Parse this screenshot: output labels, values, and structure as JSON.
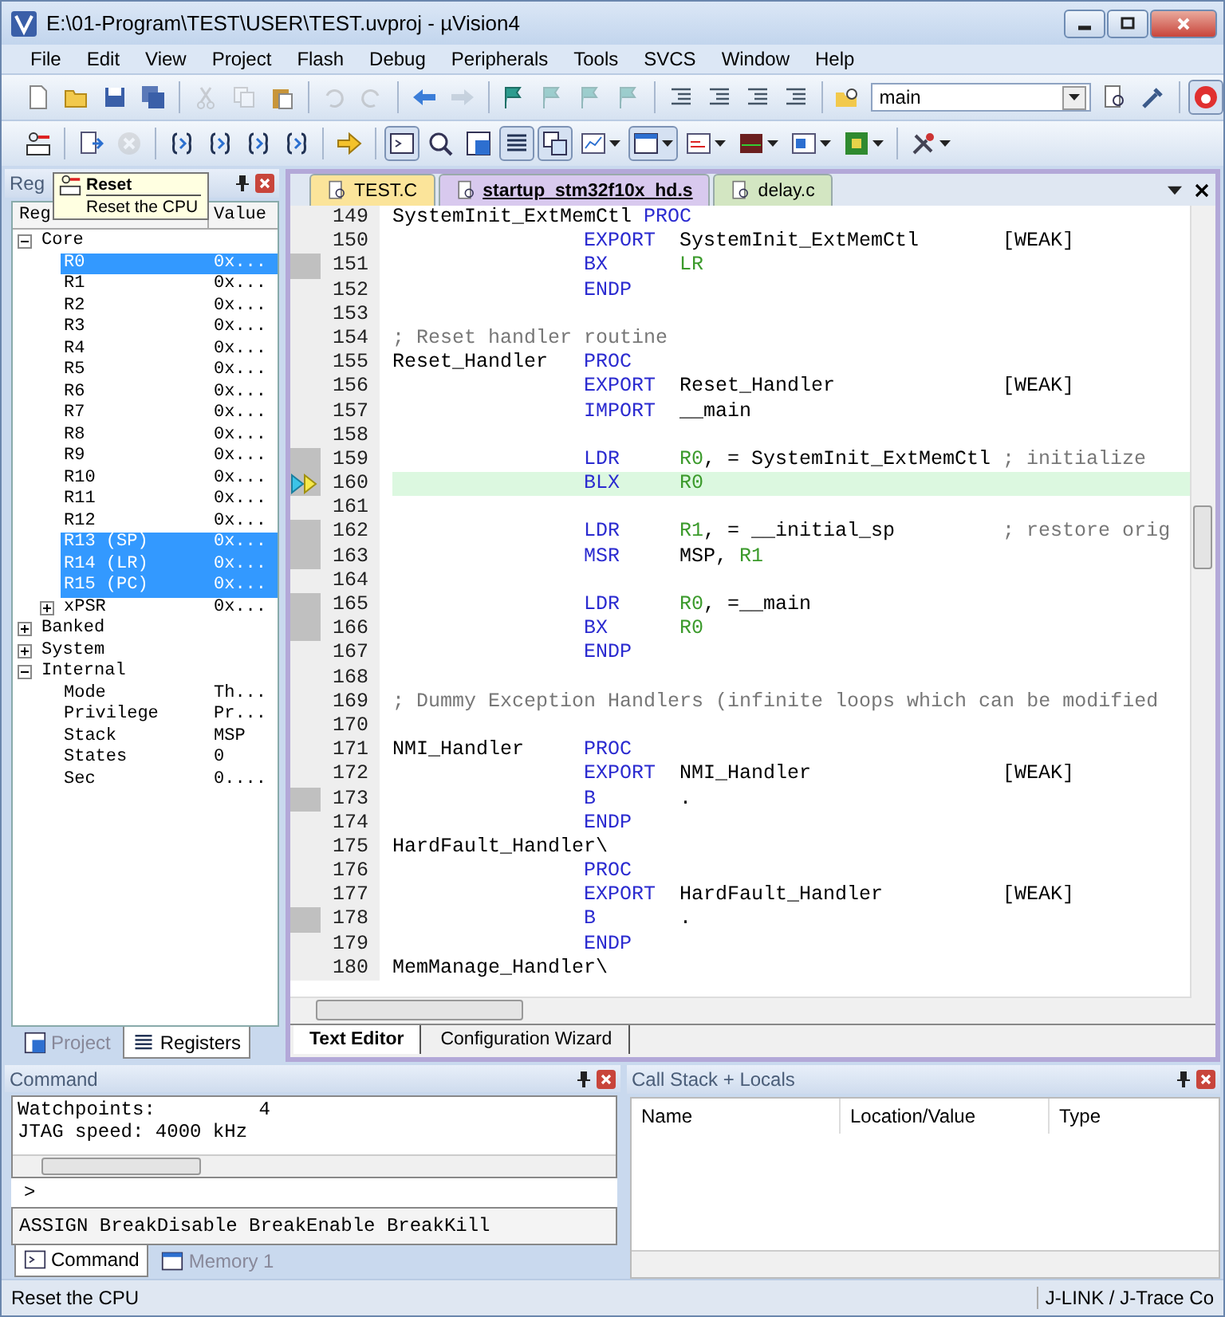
{
  "window": {
    "title": "E:\\01-Program\\TEST\\USER\\TEST.uvproj - µVision4"
  },
  "menu": [
    "File",
    "Edit",
    "View",
    "Project",
    "Flash",
    "Debug",
    "Peripherals",
    "Tools",
    "SVCS",
    "Window",
    "Help"
  ],
  "toolbar_1": [
    {
      "kind": "new-file",
      "disabled": false,
      "pressed": false
    },
    {
      "kind": "open-folder",
      "disabled": false,
      "pressed": false
    },
    {
      "kind": "save",
      "disabled": false,
      "pressed": false
    },
    {
      "kind": "save-all",
      "disabled": false,
      "pressed": false
    },
    {
      "kind": "separator"
    },
    {
      "kind": "cut",
      "disabled": true,
      "pressed": false
    },
    {
      "kind": "copy",
      "disabled": true,
      "pressed": false
    },
    {
      "kind": "paste",
      "disabled": false,
      "pressed": false
    },
    {
      "kind": "separator"
    },
    {
      "kind": "undo",
      "disabled": true,
      "pressed": false
    },
    {
      "kind": "redo",
      "disabled": true,
      "pressed": false
    },
    {
      "kind": "separator"
    },
    {
      "kind": "back-arrow",
      "disabled": false,
      "pressed": false
    },
    {
      "kind": "forward-arrow",
      "disabled": true,
      "pressed": false
    },
    {
      "kind": "separator"
    },
    {
      "kind": "bookmark-flag",
      "disabled": false,
      "pressed": false
    },
    {
      "kind": "bookmark-flag",
      "disabled": true,
      "pressed": false
    },
    {
      "kind": "bookmark-flag",
      "disabled": true,
      "pressed": false
    },
    {
      "kind": "bookmark-flag",
      "disabled": true,
      "pressed": false
    },
    {
      "kind": "separator"
    },
    {
      "kind": "indent",
      "disabled": false,
      "pressed": false
    },
    {
      "kind": "unindent",
      "disabled": false,
      "pressed": false
    },
    {
      "kind": "comment",
      "disabled": false,
      "pressed": false
    },
    {
      "kind": "uncomment",
      "disabled": false,
      "pressed": false
    },
    {
      "kind": "separator"
    },
    {
      "kind": "folder-search",
      "disabled": false,
      "pressed": false
    },
    {
      "kind": "combo",
      "value": "main"
    },
    {
      "kind": "document-search",
      "disabled": false,
      "pressed": false
    },
    {
      "kind": "tool",
      "disabled": false,
      "pressed": false
    },
    {
      "kind": "separator"
    },
    {
      "kind": "debug",
      "disabled": false,
      "pressed": true
    }
  ],
  "toolbar_2": [
    {
      "kind": "reset",
      "disabled": false,
      "pressed": false,
      "dropdown": false
    },
    {
      "kind": "separator"
    },
    {
      "kind": "run",
      "disabled": false,
      "pressed": false,
      "dropdown": false
    },
    {
      "kind": "stop",
      "disabled": true,
      "pressed": false,
      "dropdown": false
    },
    {
      "kind": "separator"
    },
    {
      "kind": "step-into",
      "disabled": false,
      "pressed": false,
      "dropdown": false
    },
    {
      "kind": "step-over",
      "disabled": false,
      "pressed": false,
      "dropdown": false
    },
    {
      "kind": "step-out",
      "disabled": false,
      "pressed": false,
      "dropdown": false
    },
    {
      "kind": "run-to-cursor",
      "disabled": false,
      "pressed": false,
      "dropdown": false
    },
    {
      "kind": "separator"
    },
    {
      "kind": "show-next",
      "disabled": false,
      "pressed": false,
      "dropdown": false
    },
    {
      "kind": "separator"
    },
    {
      "kind": "command-window",
      "disabled": false,
      "pressed": true,
      "dropdown": false
    },
    {
      "kind": "disassembly",
      "disabled": false,
      "pressed": false,
      "dropdown": false
    },
    {
      "kind": "symbols",
      "disabled": false,
      "pressed": false,
      "dropdown": false
    },
    {
      "kind": "registers",
      "disabled": false,
      "pressed": true,
      "dropdown": false
    },
    {
      "kind": "call-stack",
      "disabled": false,
      "pressed": true,
      "dropdown": false
    },
    {
      "kind": "watch",
      "disabled": false,
      "pressed": false,
      "dropdown": true
    },
    {
      "kind": "memory",
      "disabled": false,
      "pressed": true,
      "dropdown": true
    },
    {
      "kind": "serial",
      "disabled": false,
      "pressed": false,
      "dropdown": true
    },
    {
      "kind": "analysis",
      "disabled": false,
      "pressed": false,
      "dropdown": true
    },
    {
      "kind": "trace",
      "disabled": false,
      "pressed": false,
      "dropdown": true
    },
    {
      "kind": "system-viewer",
      "disabled": false,
      "pressed": false,
      "dropdown": true
    },
    {
      "kind": "separator"
    },
    {
      "kind": "tools",
      "disabled": false,
      "pressed": false,
      "dropdown": true
    }
  ],
  "tooltip": {
    "title": "Reset",
    "text": "Reset the CPU"
  },
  "registers_panel": {
    "title": "Reg",
    "columns": [
      "Reg",
      "Value"
    ],
    "tree": [
      {
        "name": "Core",
        "expanded": true,
        "selected": false,
        "children": [
          {
            "name": "R0",
            "value": "0x...",
            "selected": true
          },
          {
            "name": "R1",
            "value": "0x...",
            "selected": false
          },
          {
            "name": "R2",
            "value": "0x...",
            "selected": false
          },
          {
            "name": "R3",
            "value": "0x...",
            "selected": false
          },
          {
            "name": "R4",
            "value": "0x...",
            "selected": false
          },
          {
            "name": "R5",
            "value": "0x...",
            "selected": false
          },
          {
            "name": "R6",
            "value": "0x...",
            "selected": false
          },
          {
            "name": "R7",
            "value": "0x...",
            "selected": false
          },
          {
            "name": "R8",
            "value": "0x...",
            "selected": false
          },
          {
            "name": "R9",
            "value": "0x...",
            "selected": false
          },
          {
            "name": "R10",
            "value": "0x...",
            "selected": false
          },
          {
            "name": "R11",
            "value": "0x...",
            "selected": false
          },
          {
            "name": "R12",
            "value": "0x...",
            "selected": false
          },
          {
            "name": "R13 (SP)",
            "value": "0x...",
            "selected": true
          },
          {
            "name": "R14 (LR)",
            "value": "0x...",
            "selected": true
          },
          {
            "name": "R15 (PC)",
            "value": "0x...",
            "selected": true
          },
          {
            "name": "xPSR",
            "value": "0x...",
            "expanded": false,
            "selected": false
          }
        ]
      },
      {
        "name": "Banked",
        "expanded": false,
        "selected": false
      },
      {
        "name": "System",
        "expanded": false,
        "selected": false
      },
      {
        "name": "Internal",
        "expanded": true,
        "selected": false,
        "children": [
          {
            "name": "Mode",
            "value": "Th...",
            "selected": false
          },
          {
            "name": "Privilege",
            "value": "Pr...",
            "selected": false
          },
          {
            "name": "Stack",
            "value": "MSP",
            "selected": false
          },
          {
            "name": "States",
            "value": "0",
            "selected": false
          },
          {
            "name": "Sec",
            "value": "0....",
            "selected": false
          }
        ]
      }
    ]
  },
  "left_tabs": [
    {
      "label": "Project",
      "selected": false
    },
    {
      "label": "Registers",
      "selected": true
    }
  ],
  "editor_tabs": [
    {
      "label": "TEST.C",
      "selected": false,
      "color": "#fbe49a"
    },
    {
      "label": "startup_stm32f10x_hd.s",
      "selected": true,
      "color": "#d8c9ee"
    },
    {
      "label": "delay.c",
      "selected": false,
      "color": "#d3e6c2"
    }
  ],
  "lines": [
    {
      "num": "149",
      "label": "SystemInit_ExtMemCtl",
      "op": "PROC",
      "executable": false,
      "current": false
    },
    {
      "num": "150",
      "op": "EXPORT",
      "operands": [
        {
          "text": "SystemInit_ExtMemCtl",
          "kind": "plain"
        }
      ],
      "tail": {
        "kind": "attribute",
        "text": "[WEAK]"
      },
      "executable": false,
      "current": false
    },
    {
      "num": "151",
      "op": "BX",
      "operands": [
        {
          "text": "LR",
          "kind": "register"
        }
      ],
      "executable": true,
      "current": false
    },
    {
      "num": "152",
      "op": "ENDP",
      "executable": false,
      "current": false
    },
    {
      "num": "153",
      "executable": false,
      "current": false
    },
    {
      "num": "154",
      "comment": "; Reset handler routine",
      "executable": false,
      "current": false
    },
    {
      "num": "155",
      "label": "Reset_Handler",
      "op": "PROC",
      "executable": false,
      "current": false
    },
    {
      "num": "156",
      "op": "EXPORT",
      "operands": [
        {
          "text": "Reset_Handler",
          "kind": "plain"
        }
      ],
      "tail": {
        "kind": "attribute",
        "text": "[WEAK]"
      },
      "executable": false,
      "current": false
    },
    {
      "num": "157",
      "op": "IMPORT",
      "operands": [
        {
          "text": "__main",
          "kind": "plain"
        }
      ],
      "executable": false,
      "current": false
    },
    {
      "num": "158",
      "executable": false,
      "current": false
    },
    {
      "num": "159",
      "op": "LDR",
      "operands": [
        {
          "text": "R0",
          "kind": "register"
        },
        {
          "text": ", = SystemInit_ExtMemCtl",
          "kind": "plain"
        }
      ],
      "tail": {
        "kind": "comment",
        "text": "; initialize"
      },
      "executable": true,
      "current": false
    },
    {
      "num": "160",
      "op": "BLX",
      "operands": [
        {
          "text": "R0",
          "kind": "register"
        }
      ],
      "executable": true,
      "current": true
    },
    {
      "num": "161",
      "executable": false,
      "current": false
    },
    {
      "num": "162",
      "op": "LDR",
      "operands": [
        {
          "text": "R1",
          "kind": "register"
        },
        {
          "text": ", = __initial_sp",
          "kind": "plain"
        }
      ],
      "tail": {
        "kind": "comment",
        "text": "; restore orig"
      },
      "executable": true,
      "current": false
    },
    {
      "num": "163",
      "op": "MSR",
      "operands": [
        {
          "text": "MSP, ",
          "kind": "plain"
        },
        {
          "text": "R1",
          "kind": "register"
        }
      ],
      "executable": true,
      "current": false
    },
    {
      "num": "164",
      "executable": false,
      "current": false
    },
    {
      "num": "165",
      "op": "LDR",
      "operands": [
        {
          "text": "R0",
          "kind": "register"
        },
        {
          "text": ", =__main",
          "kind": "plain"
        }
      ],
      "executable": true,
      "current": false
    },
    {
      "num": "166",
      "op": "BX",
      "operands": [
        {
          "text": "R0",
          "kind": "register"
        }
      ],
      "executable": true,
      "current": false
    },
    {
      "num": "167",
      "op": "ENDP",
      "executable": false,
      "current": false
    },
    {
      "num": "168",
      "executable": false,
      "current": false
    },
    {
      "num": "169",
      "comment": "; Dummy Exception Handlers (infinite loops which can be modified",
      "executable": false,
      "current": false
    },
    {
      "num": "170",
      "executable": false,
      "current": false
    },
    {
      "num": "171",
      "label": "NMI_Handler",
      "op": "PROC",
      "executable": false,
      "current": false
    },
    {
      "num": "172",
      "op": "EXPORT",
      "operands": [
        {
          "text": "NMI_Handler",
          "kind": "plain"
        }
      ],
      "tail": {
        "kind": "attribute",
        "text": "[WEAK]"
      },
      "executable": false,
      "current": false
    },
    {
      "num": "173",
      "op": "B",
      "operands": [
        {
          "text": ".",
          "kind": "plain"
        }
      ],
      "executable": true,
      "current": false
    },
    {
      "num": "174",
      "op": "ENDP",
      "executable": false,
      "current": false
    },
    {
      "num": "175",
      "label": "HardFault_Handler\\",
      "executable": false,
      "current": false
    },
    {
      "num": "176",
      "op": "PROC",
      "executable": false,
      "current": false
    },
    {
      "num": "177",
      "op": "EXPORT",
      "operands": [
        {
          "text": "HardFault_Handler",
          "kind": "plain"
        }
      ],
      "tail": {
        "kind": "attribute",
        "text": "[WEAK]"
      },
      "executable": false,
      "current": false
    },
    {
      "num": "178",
      "op": "B",
      "operands": [
        {
          "text": ".",
          "kind": "plain"
        }
      ],
      "executable": true,
      "current": false
    },
    {
      "num": "179",
      "op": "ENDP",
      "executable": false,
      "current": false
    },
    {
      "num": "180",
      "label": "MemManage_Handler\\",
      "executable": false,
      "current": false
    }
  ],
  "editor_bottom_tabs": [
    {
      "label": "Text Editor",
      "selected": true
    },
    {
      "label": "Configuration Wizard",
      "selected": false
    }
  ],
  "command_panel": {
    "title": "Command",
    "output": [
      "Watchpoints:         4",
      "JTAG speed: 4000 kHz"
    ],
    "prompt": ">",
    "hint": "ASSIGN BreakDisable BreakEnable BreakKill",
    "tabs": [
      {
        "label": "Command",
        "selected": true
      },
      {
        "label": "Memory 1",
        "selected": false
      }
    ]
  },
  "call_stack_panel": {
    "title": "Call Stack + Locals",
    "columns": [
      "Name",
      "Location/Value",
      "Type"
    ]
  },
  "status_bar": [
    "Reset the CPU",
    "J-LINK / J-Trace Co"
  ]
}
